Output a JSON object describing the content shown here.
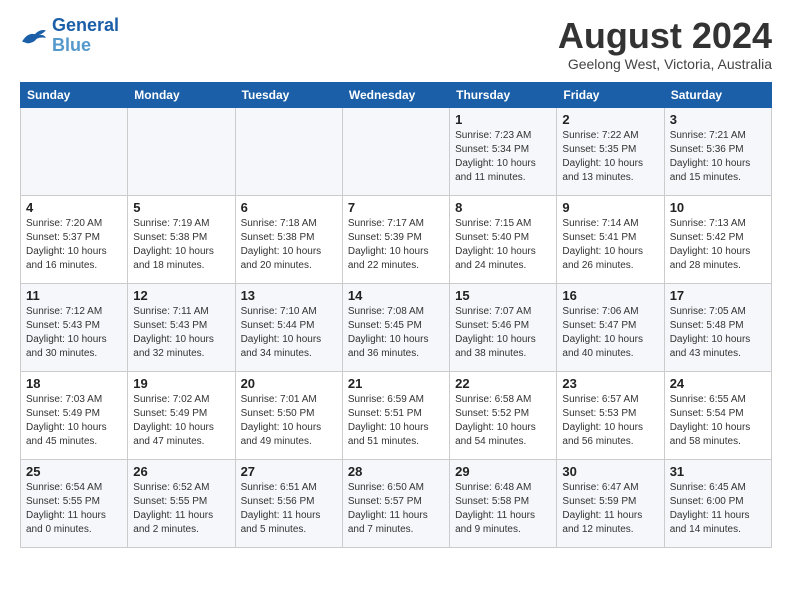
{
  "header": {
    "logo_line1": "General",
    "logo_line2": "Blue",
    "month_year": "August 2024",
    "location": "Geelong West, Victoria, Australia"
  },
  "days_of_week": [
    "Sunday",
    "Monday",
    "Tuesday",
    "Wednesday",
    "Thursday",
    "Friday",
    "Saturday"
  ],
  "weeks": [
    [
      {
        "day": "",
        "info": ""
      },
      {
        "day": "",
        "info": ""
      },
      {
        "day": "",
        "info": ""
      },
      {
        "day": "",
        "info": ""
      },
      {
        "day": "1",
        "info": "Sunrise: 7:23 AM\nSunset: 5:34 PM\nDaylight: 10 hours\nand 11 minutes."
      },
      {
        "day": "2",
        "info": "Sunrise: 7:22 AM\nSunset: 5:35 PM\nDaylight: 10 hours\nand 13 minutes."
      },
      {
        "day": "3",
        "info": "Sunrise: 7:21 AM\nSunset: 5:36 PM\nDaylight: 10 hours\nand 15 minutes."
      }
    ],
    [
      {
        "day": "4",
        "info": "Sunrise: 7:20 AM\nSunset: 5:37 PM\nDaylight: 10 hours\nand 16 minutes."
      },
      {
        "day": "5",
        "info": "Sunrise: 7:19 AM\nSunset: 5:38 PM\nDaylight: 10 hours\nand 18 minutes."
      },
      {
        "day": "6",
        "info": "Sunrise: 7:18 AM\nSunset: 5:38 PM\nDaylight: 10 hours\nand 20 minutes."
      },
      {
        "day": "7",
        "info": "Sunrise: 7:17 AM\nSunset: 5:39 PM\nDaylight: 10 hours\nand 22 minutes."
      },
      {
        "day": "8",
        "info": "Sunrise: 7:15 AM\nSunset: 5:40 PM\nDaylight: 10 hours\nand 24 minutes."
      },
      {
        "day": "9",
        "info": "Sunrise: 7:14 AM\nSunset: 5:41 PM\nDaylight: 10 hours\nand 26 minutes."
      },
      {
        "day": "10",
        "info": "Sunrise: 7:13 AM\nSunset: 5:42 PM\nDaylight: 10 hours\nand 28 minutes."
      }
    ],
    [
      {
        "day": "11",
        "info": "Sunrise: 7:12 AM\nSunset: 5:43 PM\nDaylight: 10 hours\nand 30 minutes."
      },
      {
        "day": "12",
        "info": "Sunrise: 7:11 AM\nSunset: 5:43 PM\nDaylight: 10 hours\nand 32 minutes."
      },
      {
        "day": "13",
        "info": "Sunrise: 7:10 AM\nSunset: 5:44 PM\nDaylight: 10 hours\nand 34 minutes."
      },
      {
        "day": "14",
        "info": "Sunrise: 7:08 AM\nSunset: 5:45 PM\nDaylight: 10 hours\nand 36 minutes."
      },
      {
        "day": "15",
        "info": "Sunrise: 7:07 AM\nSunset: 5:46 PM\nDaylight: 10 hours\nand 38 minutes."
      },
      {
        "day": "16",
        "info": "Sunrise: 7:06 AM\nSunset: 5:47 PM\nDaylight: 10 hours\nand 40 minutes."
      },
      {
        "day": "17",
        "info": "Sunrise: 7:05 AM\nSunset: 5:48 PM\nDaylight: 10 hours\nand 43 minutes."
      }
    ],
    [
      {
        "day": "18",
        "info": "Sunrise: 7:03 AM\nSunset: 5:49 PM\nDaylight: 10 hours\nand 45 minutes."
      },
      {
        "day": "19",
        "info": "Sunrise: 7:02 AM\nSunset: 5:49 PM\nDaylight: 10 hours\nand 47 minutes."
      },
      {
        "day": "20",
        "info": "Sunrise: 7:01 AM\nSunset: 5:50 PM\nDaylight: 10 hours\nand 49 minutes."
      },
      {
        "day": "21",
        "info": "Sunrise: 6:59 AM\nSunset: 5:51 PM\nDaylight: 10 hours\nand 51 minutes."
      },
      {
        "day": "22",
        "info": "Sunrise: 6:58 AM\nSunset: 5:52 PM\nDaylight: 10 hours\nand 54 minutes."
      },
      {
        "day": "23",
        "info": "Sunrise: 6:57 AM\nSunset: 5:53 PM\nDaylight: 10 hours\nand 56 minutes."
      },
      {
        "day": "24",
        "info": "Sunrise: 6:55 AM\nSunset: 5:54 PM\nDaylight: 10 hours\nand 58 minutes."
      }
    ],
    [
      {
        "day": "25",
        "info": "Sunrise: 6:54 AM\nSunset: 5:55 PM\nDaylight: 11 hours\nand 0 minutes."
      },
      {
        "day": "26",
        "info": "Sunrise: 6:52 AM\nSunset: 5:55 PM\nDaylight: 11 hours\nand 2 minutes."
      },
      {
        "day": "27",
        "info": "Sunrise: 6:51 AM\nSunset: 5:56 PM\nDaylight: 11 hours\nand 5 minutes."
      },
      {
        "day": "28",
        "info": "Sunrise: 6:50 AM\nSunset: 5:57 PM\nDaylight: 11 hours\nand 7 minutes."
      },
      {
        "day": "29",
        "info": "Sunrise: 6:48 AM\nSunset: 5:58 PM\nDaylight: 11 hours\nand 9 minutes."
      },
      {
        "day": "30",
        "info": "Sunrise: 6:47 AM\nSunset: 5:59 PM\nDaylight: 11 hours\nand 12 minutes."
      },
      {
        "day": "31",
        "info": "Sunrise: 6:45 AM\nSunset: 6:00 PM\nDaylight: 11 hours\nand 14 minutes."
      }
    ]
  ]
}
